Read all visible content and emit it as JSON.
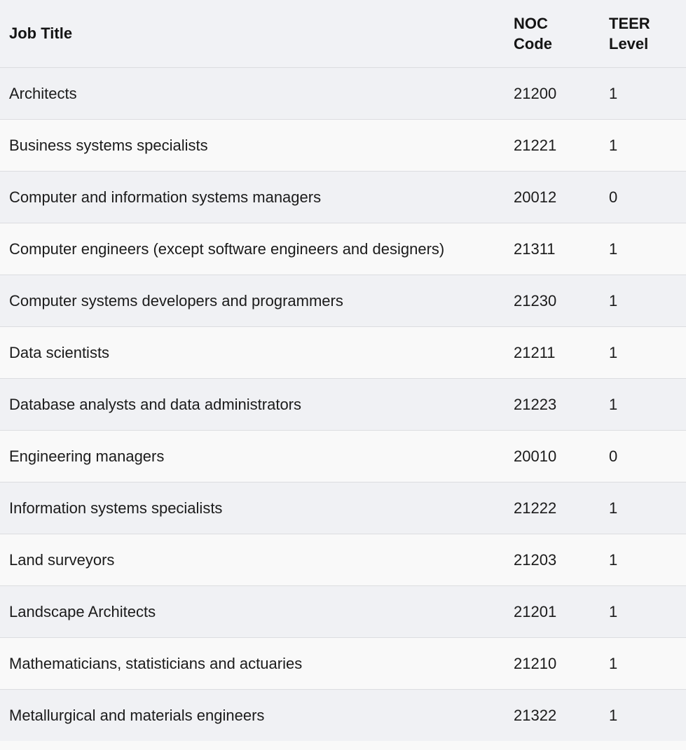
{
  "headers": {
    "job_title": "Job Title",
    "noc_code_line1": "NOC",
    "noc_code_line2": "Code",
    "teer_level_line1": "TEER",
    "teer_level_line2": "Level"
  },
  "rows": [
    {
      "title": "Architects",
      "noc": "21200",
      "teer": "1"
    },
    {
      "title": "Business systems specialists",
      "noc": "21221",
      "teer": "1"
    },
    {
      "title": "Computer and information systems managers",
      "noc": "20012",
      "teer": "0"
    },
    {
      "title": "Computer engineers (except software engineers and designers)",
      "noc": "21311",
      "teer": "1"
    },
    {
      "title": "Computer systems developers and programmers",
      "noc": "21230",
      "teer": "1"
    },
    {
      "title": "Data scientists",
      "noc": "21211",
      "teer": "1"
    },
    {
      "title": "Database analysts and data administrators",
      "noc": "21223",
      "teer": "1"
    },
    {
      "title": "Engineering managers",
      "noc": "20010",
      "teer": "0"
    },
    {
      "title": "Information systems specialists",
      "noc": "21222",
      "teer": "1"
    },
    {
      "title": "Land surveyors",
      "noc": "21203",
      "teer": "1"
    },
    {
      "title": "Landscape Architects",
      "noc": "21201",
      "teer": "1"
    },
    {
      "title": "Mathematicians, statisticians and actuaries",
      "noc": "21210",
      "teer": "1"
    },
    {
      "title": "Metallurgical and materials engineers",
      "noc": "21322",
      "teer": "1"
    }
  ]
}
